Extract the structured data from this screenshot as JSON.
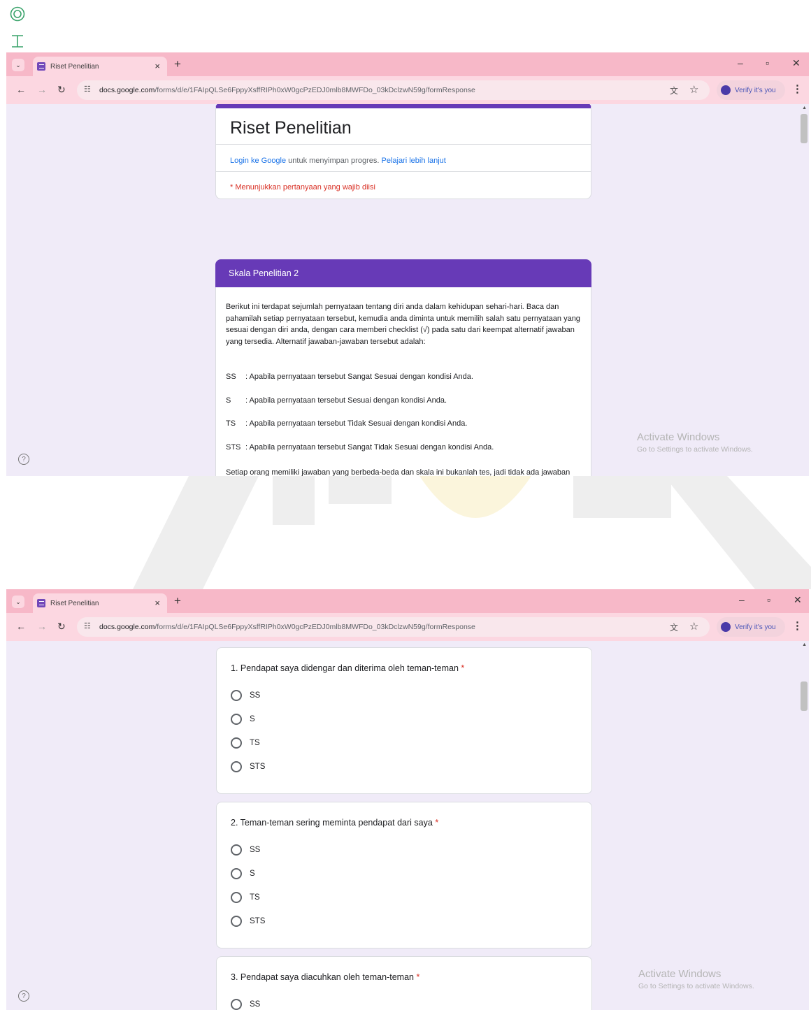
{
  "margin_icons": [
    "circle-target-icon",
    "text-cursor-icon"
  ],
  "browser": {
    "tab_title": "Riset Penelitian",
    "url_host": "docs.google.com",
    "url_path": "/forms/d/e/1FAIpQLSe6FppyXsffRIPh0xW0gcPzEDJ0mlb8MWFDo_03kDclzwN59g/formResponse",
    "verify_label": "Verify it's you"
  },
  "form": {
    "title": "Riset Penelitian",
    "login_link": "Login ke Google",
    "login_text": " untuk menyimpan progres. ",
    "learn_more": "Pelajari lebih lanjut",
    "required_note": "* Menunjukkan pertanyaan yang wajib diisi"
  },
  "section": {
    "title": "Skala Penelitian 2",
    "intro": "Berikut ini terdapat sejumlah pernyataan tentang diri anda dalam kehidupan sehari-hari. Baca dan pahamilah setiap pernyataan tersebut, kemudia anda diminta untuk memilih salah satu pernyataan yang sesuai dengan diri anda, dengan cara memberi checklist (√) pada satu dari keempat alternatif jawaban yang tersedia. Alternatif jawaban-jawaban tersebut adalah:",
    "legend": [
      {
        "code": "SS",
        "text": ": Apabila pernyataan tersebut Sangat Sesuai dengan kondisi Anda."
      },
      {
        "code": "S",
        "text": ": Apabila pernyataan tersebut Sesuai dengan kondisi Anda."
      },
      {
        "code": "TS",
        "text": ": Apabila pernyataan tersebut Tidak Sesuai dengan kondisi Anda."
      },
      {
        "code": "STS",
        "text": ": Apabila pernyataan tersebut Sangat Tidak Sesuai dengan kondisi Anda."
      }
    ],
    "closing": "Setiap orang memiliki jawaban yang berbeda-beda dan skala ini bukanlah tes, jadi tidak ada jawaban yang dianggap salah. Semua jawaban adalah benar, karena itu pilihlah jawaban yang paling sesuai dengan diri anda. Saya sangat mengharapkan anda memberikan jawaban yang jujur, terbuka dan apa adanya. Semua identitas dan jawaban anda akan dijaga kerahasiaannya dan hanya akan digunakan untuk kepentingan penelitian ini."
  },
  "questions": [
    {
      "text": "1.  Pendapat saya didengar dan diterima oleh teman-teman",
      "options": [
        "SS",
        "S",
        "TS",
        "STS"
      ]
    },
    {
      "text": "2.  Teman-teman sering meminta pendapat dari saya",
      "options": [
        "SS",
        "S",
        "TS",
        "STS"
      ]
    },
    {
      "text": "3.  Pendapat saya diacuhkan oleh teman-teman",
      "options": [
        "SS"
      ]
    }
  ],
  "required_mark": "*",
  "windows_notice": {
    "line1": "Activate Windows",
    "line2": "Go to Settings to activate Windows."
  },
  "help_glyph": "?"
}
